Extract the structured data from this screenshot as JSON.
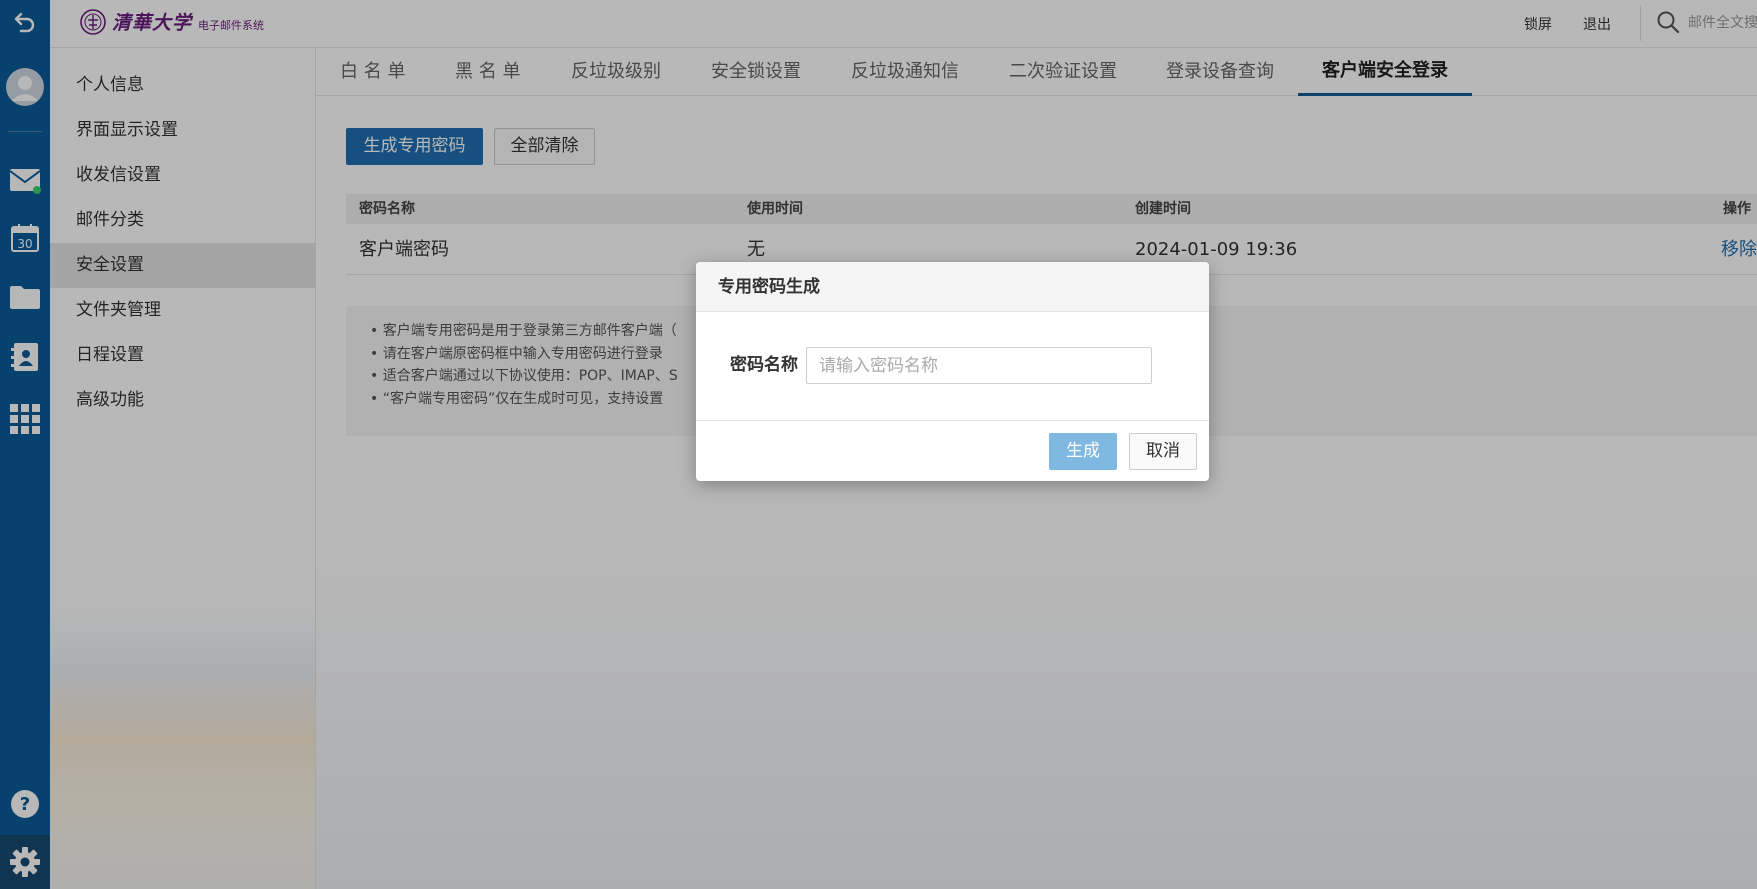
{
  "topbar": {
    "logo_text": "清華大学",
    "logo_sub": "电子邮件系统",
    "lock_label": "锁屏",
    "logout_label": "退出",
    "search_placeholder": "邮件全文搜"
  },
  "rail": {
    "icons": [
      "back-icon",
      "avatar-icon",
      "mail-icon",
      "calendar-icon",
      "folder-icon",
      "contacts-icon",
      "apps-grid-icon",
      "help-icon",
      "gear-icon"
    ],
    "calendar_day": "30"
  },
  "sidebar": {
    "items": [
      {
        "label": "个人信息"
      },
      {
        "label": "界面显示设置"
      },
      {
        "label": "收发信设置"
      },
      {
        "label": "邮件分类"
      },
      {
        "label": "安全设置"
      },
      {
        "label": "文件夹管理"
      },
      {
        "label": "日程设置"
      },
      {
        "label": "高级功能"
      }
    ],
    "active_index": 4
  },
  "tabs": [
    {
      "label": "白 名 单"
    },
    {
      "label": "黑 名 单"
    },
    {
      "label": "反垃圾级别"
    },
    {
      "label": "安全锁设置"
    },
    {
      "label": "反垃圾通知信"
    },
    {
      "label": "二次验证设置"
    },
    {
      "label": "登录设备查询"
    },
    {
      "label": "客户端安全登录"
    }
  ],
  "active_tab": 7,
  "actions": {
    "generate_label": "生成专用密码",
    "clear_label": "全部清除"
  },
  "table": {
    "headers": [
      "密码名称",
      "使用时间",
      "创建时间",
      "操作"
    ],
    "rows": [
      {
        "name": "客户端密码",
        "used": "无",
        "created": "2024-01-09 19:36",
        "action": "移除"
      }
    ]
  },
  "tips": [
    "• 客户端专用密码是用于登录第三方邮件客户端（",
    "• 请在客户端原密码框中输入专用密码进行登录",
    "• 适合客户端通过以下协议使用：POP、IMAP、S",
    "• “客户端专用密码”仅在生成时可见，支持设置"
  ],
  "dialog": {
    "title": "专用密码生成",
    "field_label": "密码名称",
    "field_placeholder": "请输入密码名称",
    "field_value": "",
    "ok_label": "生成",
    "cancel_label": "取消"
  },
  "colors": {
    "rail": "#0b5a97",
    "primary": "#1f6fb2",
    "link": "#1f6fb2",
    "logo": "#6a1e7d",
    "disabled_primary": "#7fb8e0"
  }
}
